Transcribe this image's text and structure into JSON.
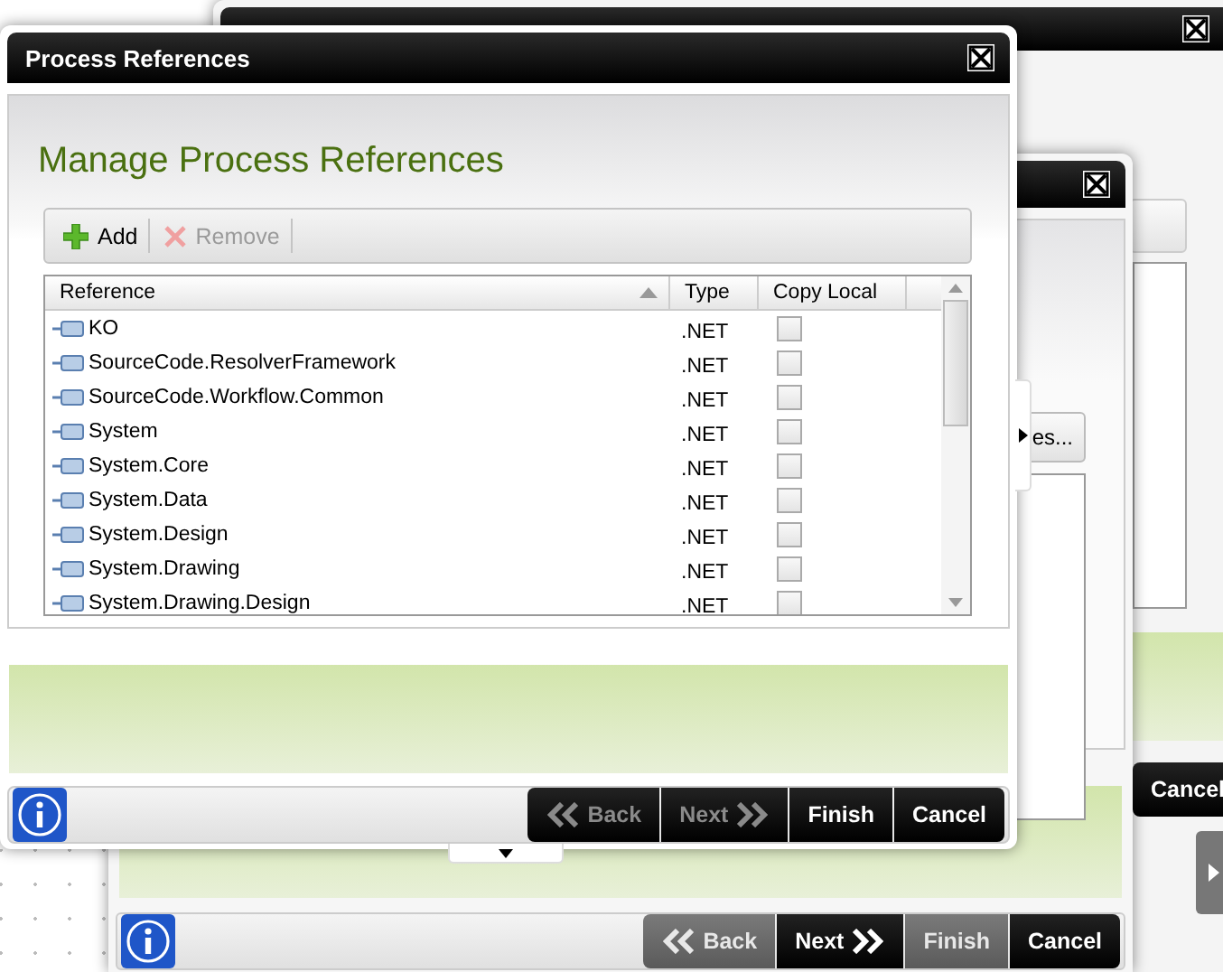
{
  "back_window": {
    "buttons": [
      {
        "label": "Cancel",
        "disabled": false
      }
    ]
  },
  "middle_window": {
    "partial_button": "es...",
    "buttons": [
      {
        "label": "Back",
        "disabled": true
      },
      {
        "label": "Next",
        "disabled": false
      },
      {
        "label": "Finish",
        "disabled": true
      },
      {
        "label": "Cancel",
        "disabled": false
      }
    ]
  },
  "dialog": {
    "title": "Process References",
    "heading": "Manage Process References",
    "toolbar": [
      {
        "label": "Add",
        "disabled": false
      },
      {
        "label": "Remove",
        "disabled": true
      }
    ],
    "table": {
      "columns": [
        {
          "label": "Reference",
          "sorted": true
        },
        {
          "label": "Type",
          "sorted": false
        },
        {
          "label": "Copy Local",
          "sorted": false
        }
      ],
      "rows": [
        {
          "reference": "KO",
          "type": ".NET",
          "copy_local": false
        },
        {
          "reference": "SourceCode.ResolverFramework",
          "type": ".NET",
          "copy_local": false
        },
        {
          "reference": "SourceCode.Workflow.Common",
          "type": ".NET",
          "copy_local": false
        },
        {
          "reference": "System",
          "type": ".NET",
          "copy_local": false
        },
        {
          "reference": "System.Core",
          "type": ".NET",
          "copy_local": false
        },
        {
          "reference": "System.Data",
          "type": ".NET",
          "copy_local": false
        },
        {
          "reference": "System.Design",
          "type": ".NET",
          "copy_local": false
        },
        {
          "reference": "System.Drawing",
          "type": ".NET",
          "copy_local": false
        },
        {
          "reference": "System.Drawing.Design",
          "type": ".NET",
          "copy_local": false
        }
      ]
    },
    "buttons": [
      {
        "label": "Back",
        "disabled": true
      },
      {
        "label": "Next",
        "disabled": true
      },
      {
        "label": "Finish",
        "disabled": false
      },
      {
        "label": "Cancel",
        "disabled": false
      }
    ]
  }
}
